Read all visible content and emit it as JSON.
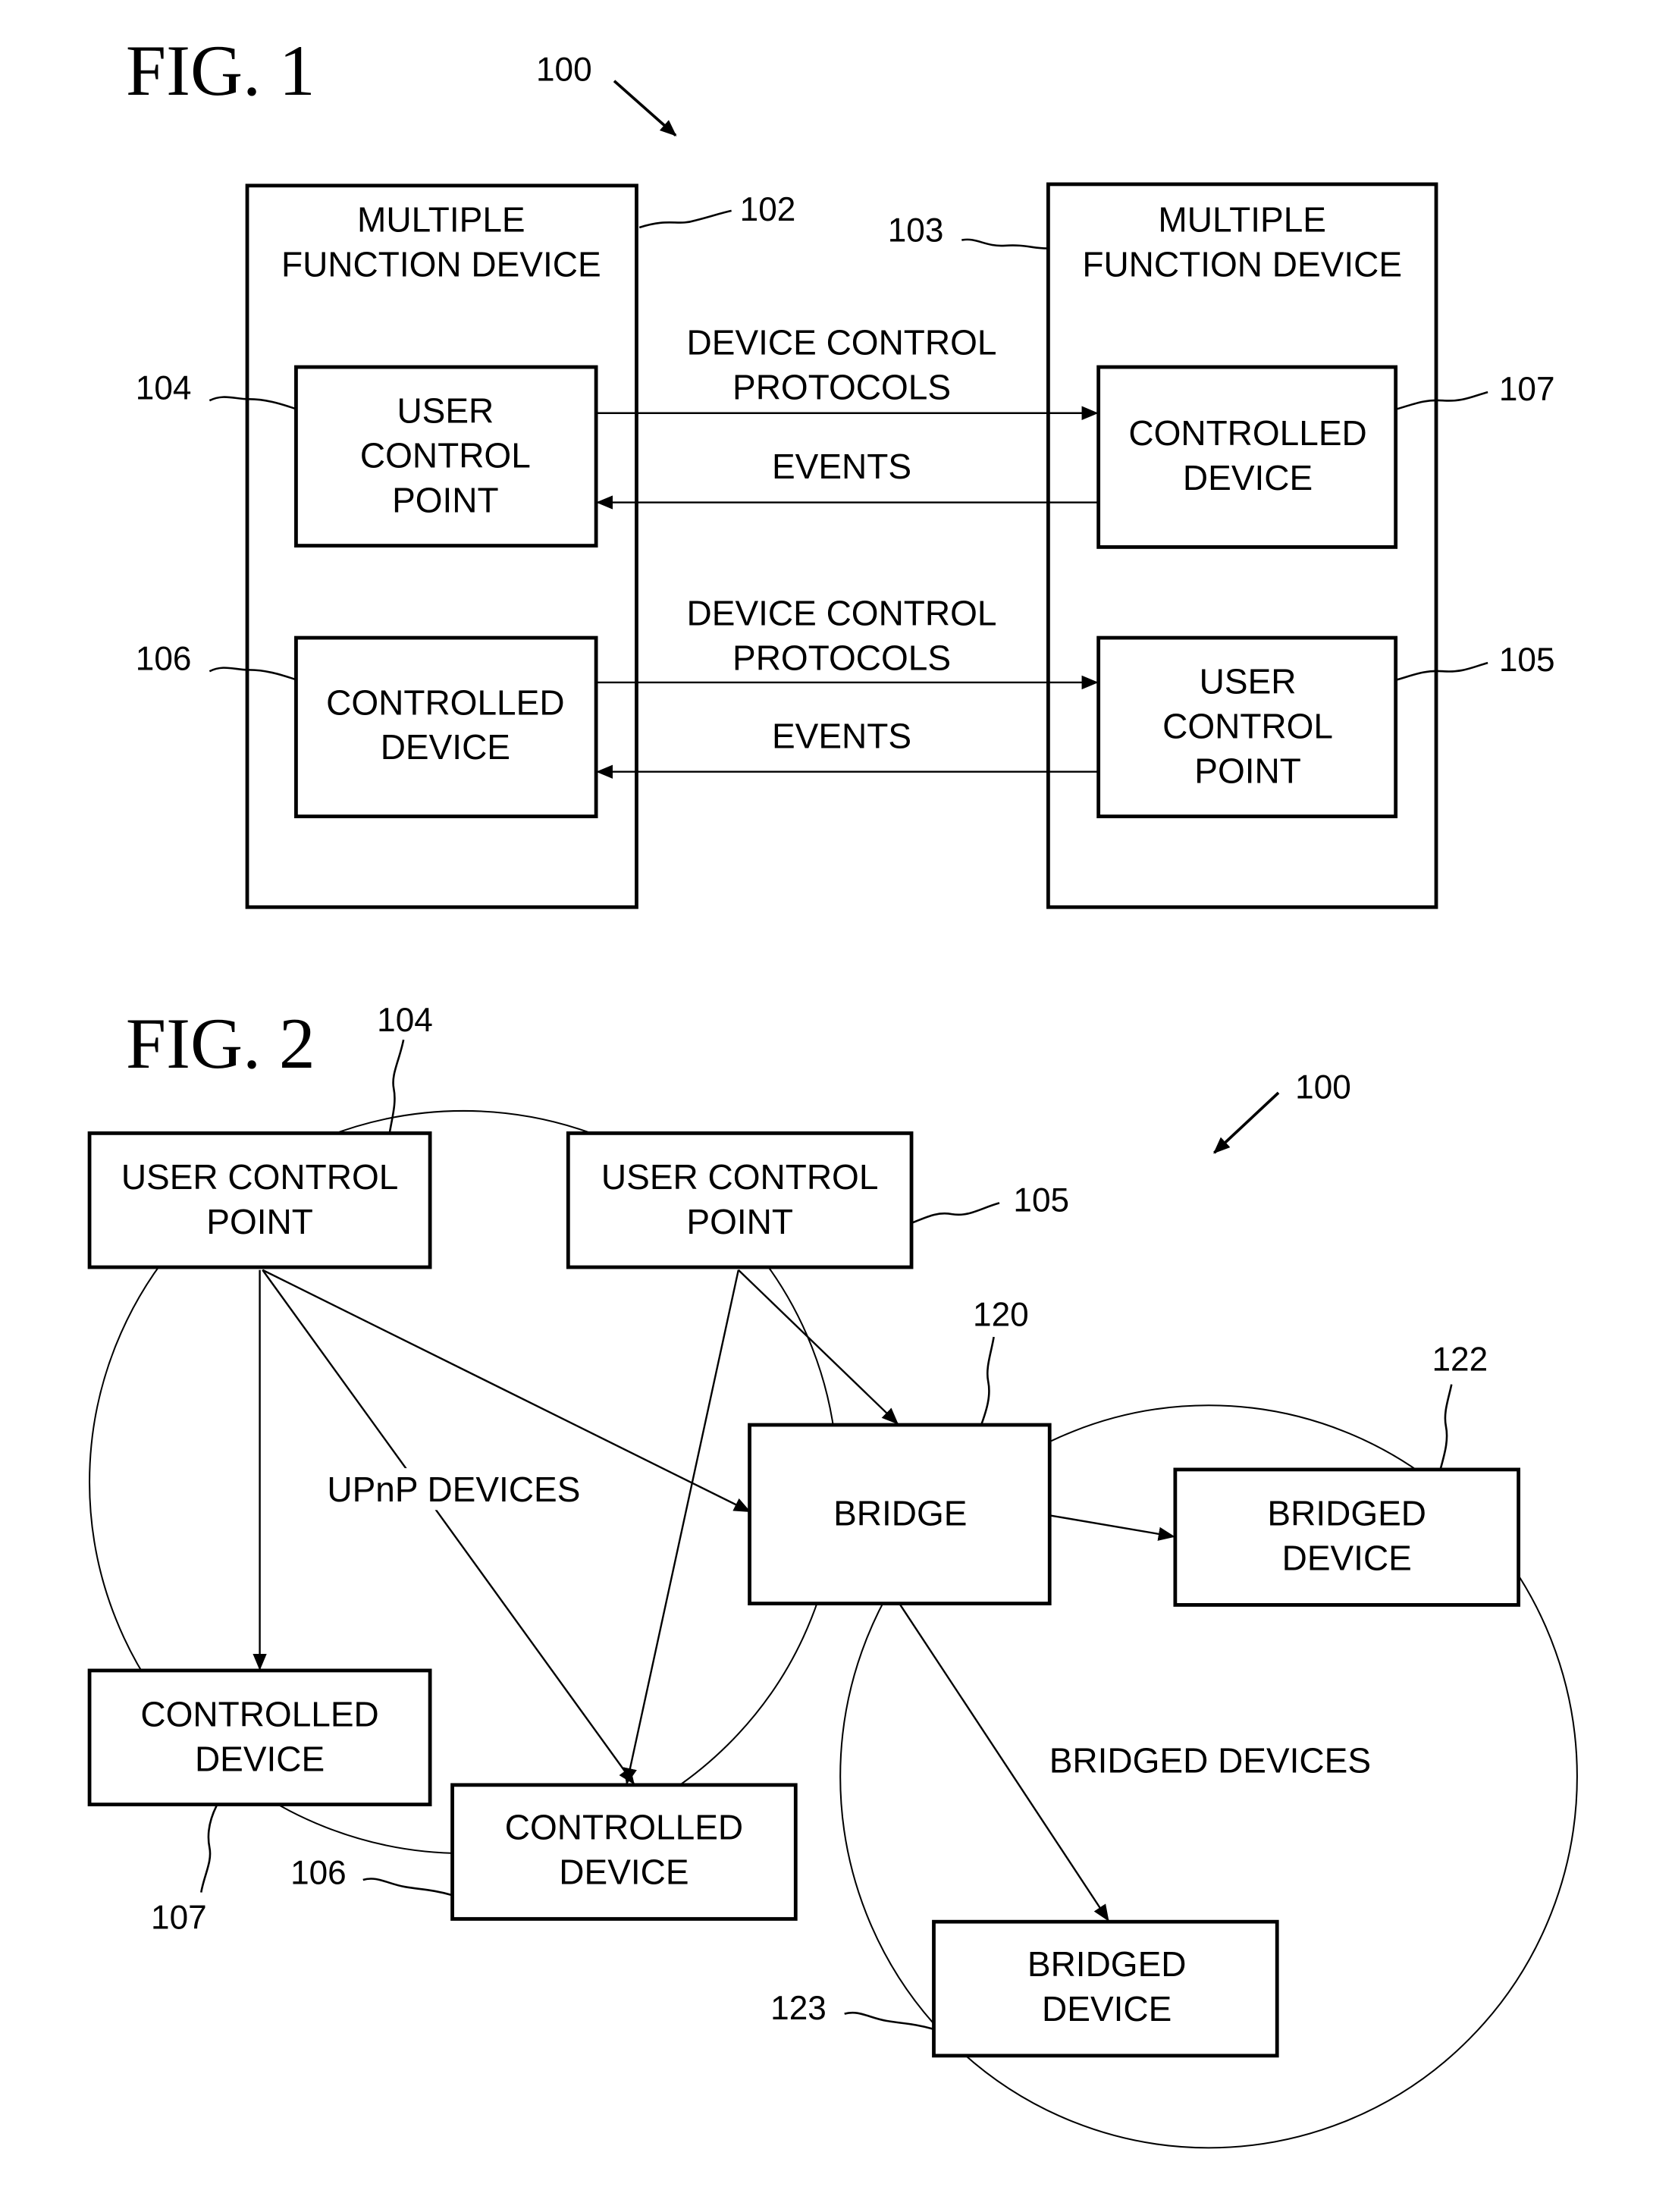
{
  "figures": [
    {
      "title": "FIG. 1",
      "system_ref": "100",
      "devices": [
        {
          "ref": "102",
          "label_lines": [
            "MULTIPLE",
            "FUNCTION DEVICE"
          ]
        },
        {
          "ref": "103",
          "label_lines": [
            "MULTIPLE",
            "FUNCTION DEVICE"
          ]
        }
      ],
      "components": [
        {
          "ref": "104",
          "label_lines": [
            "USER",
            "CONTROL",
            "POINT"
          ]
        },
        {
          "ref": "106",
          "label_lines": [
            "CONTROLLED",
            "DEVICE"
          ]
        },
        {
          "ref": "107",
          "label_lines": [
            "CONTROLLED",
            "DEVICE"
          ]
        },
        {
          "ref": "105",
          "label_lines": [
            "USER",
            "CONTROL",
            "POINT"
          ]
        }
      ],
      "connections": [
        {
          "from": "104",
          "to": "107",
          "label_lines": [
            "DEVICE CONTROL",
            "PROTOCOLS"
          ]
        },
        {
          "from": "107",
          "to": "104",
          "label_lines": [
            "EVENTS"
          ]
        },
        {
          "from": "106",
          "to": "105",
          "label_lines": [
            "DEVICE CONTROL",
            "PROTOCOLS"
          ]
        },
        {
          "from": "105",
          "to": "106",
          "label_lines": [
            "EVENTS"
          ]
        }
      ]
    },
    {
      "title": "FIG. 2",
      "system_ref": "100",
      "nodes": [
        {
          "ref": "104",
          "label_lines": [
            "USER CONTROL",
            "POINT"
          ]
        },
        {
          "ref": "105",
          "label_lines": [
            "USER CONTROL",
            "POINT"
          ]
        },
        {
          "ref": "120",
          "label_lines": [
            "BRIDGE"
          ]
        },
        {
          "ref": "122",
          "label_lines": [
            "BRIDGED",
            "DEVICE"
          ]
        },
        {
          "ref": "107",
          "label_lines": [
            "CONTROLLED",
            "DEVICE"
          ]
        },
        {
          "ref": "106",
          "label_lines": [
            "CONTROLLED",
            "DEVICE"
          ]
        },
        {
          "ref": "123",
          "label_lines": [
            "BRIDGED",
            "DEVICE"
          ]
        }
      ],
      "groups": [
        {
          "label": "UPnP DEVICES"
        },
        {
          "label": "BRIDGED DEVICES"
        }
      ],
      "edges": [
        {
          "from": "104",
          "to": "107"
        },
        {
          "from": "104",
          "to": "106"
        },
        {
          "from": "104",
          "to": "120"
        },
        {
          "from": "105",
          "to": "106"
        },
        {
          "from": "105",
          "to": "120"
        },
        {
          "from": "120",
          "to": "122"
        },
        {
          "from": "120",
          "to": "123"
        }
      ]
    }
  ]
}
